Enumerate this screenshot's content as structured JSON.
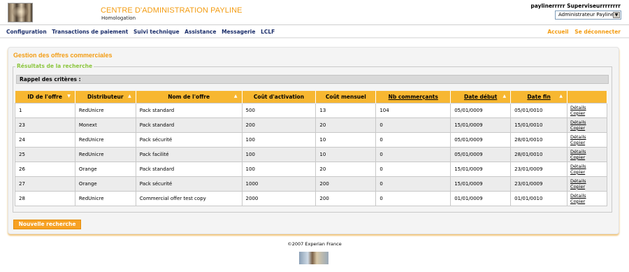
{
  "header": {
    "app_title": "CENTRE D'ADMINISTRATION PAYLINE",
    "environment": "Homologation",
    "user_name": "paylinerrrrr Superviseurrrrrrrr",
    "role_selected": "Administrateur Payline"
  },
  "nav": {
    "items": [
      "Configuration",
      "Transactions de paiement",
      "Suivi technique",
      "Assistance",
      "Messagerie",
      "LCLF"
    ],
    "right": {
      "home": "Accueil",
      "logout": "Se déconnecter"
    }
  },
  "panel": {
    "title": "Gestion des offres commerciales",
    "legend": "Résultats de la recherche",
    "criteria": "Rappel des critères :"
  },
  "table": {
    "columns": [
      "ID de l'offre",
      "Distributeur",
      "Nom de l'offre",
      "Coût d'activation",
      "Coût mensuel",
      "Nb commerçants",
      "Date début",
      "Date fin",
      ""
    ],
    "rows": [
      {
        "id": "1",
        "distributor": "RedUnicre",
        "name": "Pack standard",
        "activation": "500",
        "monthly": "13",
        "merchants": "104",
        "start": "05/01/0009",
        "end": "05/01/0010"
      },
      {
        "id": "23",
        "distributor": "Monext",
        "name": "Pack standard",
        "activation": "200",
        "monthly": "20",
        "merchants": "0",
        "start": "15/01/0009",
        "end": "15/01/0010"
      },
      {
        "id": "24",
        "distributor": "RedUnicre",
        "name": "Pack sécurité",
        "activation": "100",
        "monthly": "10",
        "merchants": "0",
        "start": "05/01/0009",
        "end": "28/01/0010"
      },
      {
        "id": "25",
        "distributor": "RedUnicre",
        "name": "Pack facilité",
        "activation": "100",
        "monthly": "10",
        "merchants": "0",
        "start": "05/01/0009",
        "end": "28/01/0010"
      },
      {
        "id": "26",
        "distributor": "Orange",
        "name": "Pack standard",
        "activation": "100",
        "monthly": "20",
        "merchants": "0",
        "start": "15/01/0009",
        "end": "23/01/0009"
      },
      {
        "id": "27",
        "distributor": "Orange",
        "name": "Pack sécurité",
        "activation": "1000",
        "monthly": "200",
        "merchants": "0",
        "start": "15/01/0009",
        "end": "23/01/0009"
      },
      {
        "id": "28",
        "distributor": "RedUnicre",
        "name": "Commercial offer test copy",
        "activation": "2000",
        "monthly": "200",
        "merchants": "0",
        "start": "01/01/0009",
        "end": "01/01/0010"
      }
    ],
    "actions": {
      "details": "Détails",
      "copy": "Copier"
    }
  },
  "buttons": {
    "new_search": "Nouvelle recherche"
  },
  "footer": {
    "copyright": "©2007 Experian France"
  },
  "colors": {
    "accent": "#f39c12",
    "table_header": "#f7b731",
    "legend": "#8cc63f",
    "nav": "#1c2f6b"
  }
}
